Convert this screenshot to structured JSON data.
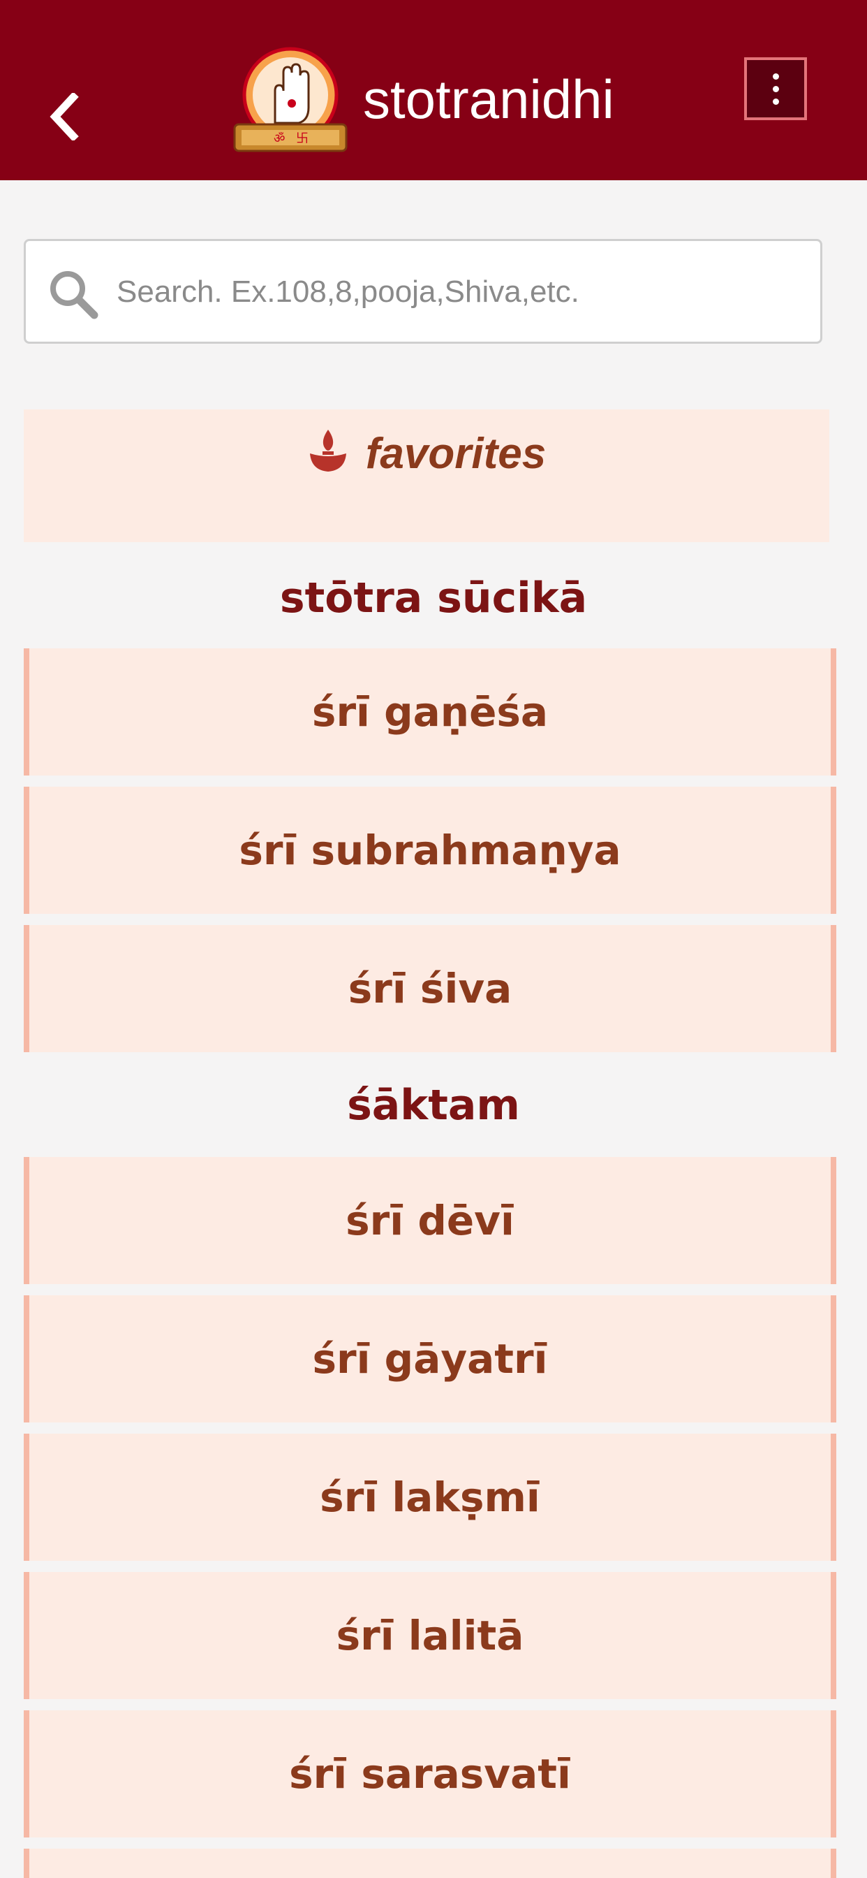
{
  "header": {
    "back_icon": "chevron-left-icon",
    "logo_icon": "blessing-hand-logo",
    "title": "stotranidhi",
    "menu_icon": "kebab-menu-icon",
    "background_color": "#860015"
  },
  "search": {
    "icon": "search-icon",
    "placeholder": "Search. Ex.108,8,pooja,Shiva,etc.",
    "value": ""
  },
  "favorites": {
    "icon": "diya-lamp-icon",
    "label": "favorites"
  },
  "sections": [
    {
      "heading": "stōtra sūcikā",
      "items": [
        {
          "label": "śrī gaṇēśa"
        },
        {
          "label": "śrī subrahmaṇya"
        },
        {
          "label": "śrī śiva"
        }
      ]
    },
    {
      "heading": "śāktam",
      "items": [
        {
          "label": "śrī dēvī"
        },
        {
          "label": "śrī gāyatrī"
        },
        {
          "label": "śrī lakṣmī"
        },
        {
          "label": "śrī lalitā"
        },
        {
          "label": "śrī sarasvatī"
        }
      ]
    }
  ],
  "colors": {
    "accent": "#860015",
    "item_background": "#fdebe3",
    "item_border": "#f6b8a5",
    "item_text": "#8b3a1c",
    "heading_text": "#7c1414"
  }
}
